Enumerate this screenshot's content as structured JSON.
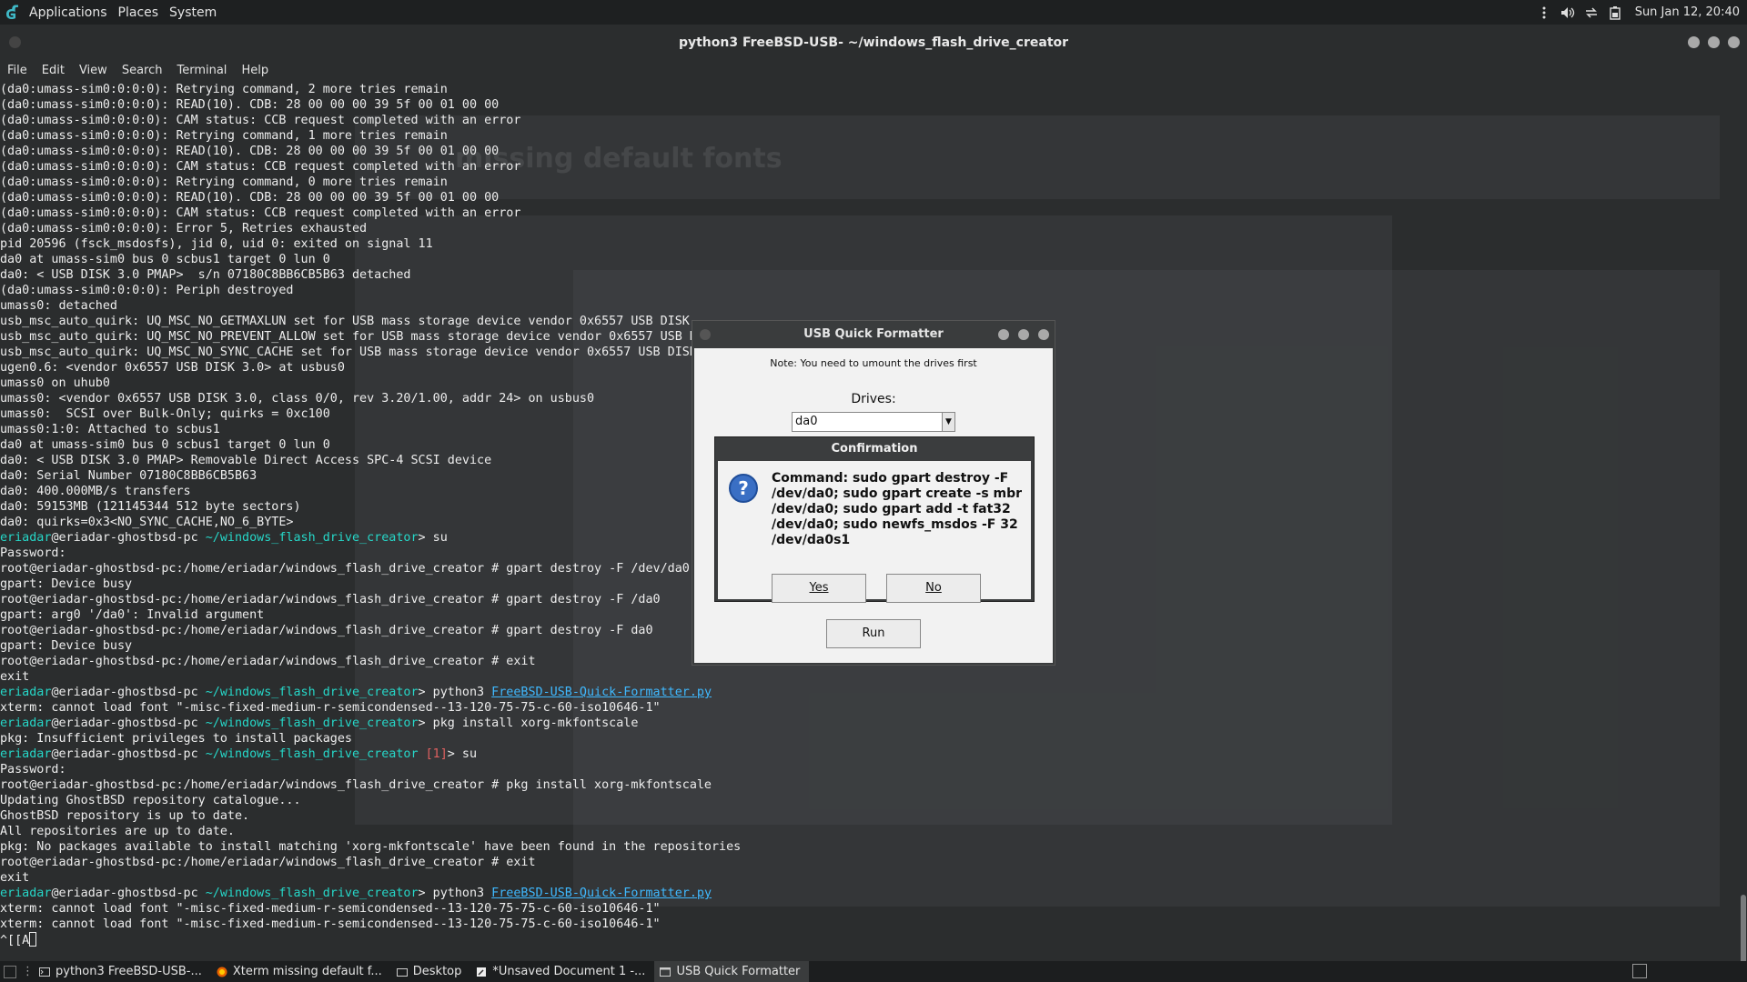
{
  "top_panel": {
    "menus": [
      "Applications",
      "Places",
      "System"
    ],
    "clock": "Sun Jan 12, 20:40"
  },
  "terminal": {
    "title": "python3 FreeBSD-USB- ~/windows_flash_drive_creator",
    "menu": [
      "File",
      "Edit",
      "View",
      "Search",
      "Terminal",
      "Help"
    ],
    "lines": [
      {
        "t": "(da0:umass-sim0:0:0:0): Retrying command, 2 more tries remain"
      },
      {
        "t": "(da0:umass-sim0:0:0:0): READ(10). CDB: 28 00 00 00 39 5f 00 01 00 00"
      },
      {
        "t": "(da0:umass-sim0:0:0:0): CAM status: CCB request completed with an error"
      },
      {
        "t": "(da0:umass-sim0:0:0:0): Retrying command, 1 more tries remain"
      },
      {
        "t": "(da0:umass-sim0:0:0:0): READ(10). CDB: 28 00 00 00 39 5f 00 01 00 00"
      },
      {
        "t": "(da0:umass-sim0:0:0:0): CAM status: CCB request completed with an error"
      },
      {
        "t": "(da0:umass-sim0:0:0:0): Retrying command, 0 more tries remain"
      },
      {
        "t": "(da0:umass-sim0:0:0:0): READ(10). CDB: 28 00 00 00 39 5f 00 01 00 00"
      },
      {
        "t": "(da0:umass-sim0:0:0:0): CAM status: CCB request completed with an error"
      },
      {
        "t": "(da0:umass-sim0:0:0:0): Error 5, Retries exhausted"
      },
      {
        "t": "pid 20596 (fsck_msdosfs), jid 0, uid 0: exited on signal 11"
      },
      {
        "t": "da0 at umass-sim0 bus 0 scbus1 target 0 lun 0"
      },
      {
        "t": "da0: < USB DISK 3.0 PMAP>  s/n 07180C8BB6CB5B63 detached"
      },
      {
        "t": "(da0:umass-sim0:0:0:0): Periph destroyed"
      },
      {
        "t": "umass0: detached"
      },
      {
        "t": "usb_msc_auto_quirk: UQ_MSC_NO_GETMAXLUN set for USB mass storage device vendor 0x6557 USB DISK"
      },
      {
        "t": "usb_msc_auto_quirk: UQ_MSC_NO_PREVENT_ALLOW set for USB mass storage device vendor 0x6557 USB D"
      },
      {
        "t": "usb_msc_auto_quirk: UQ_MSC_NO_SYNC_CACHE set for USB mass storage device vendor 0x6557 USB DISK"
      },
      {
        "t": "ugen0.6: <vendor 0x6557 USB DISK 3.0> at usbus0"
      },
      {
        "t": "umass0 on uhub0"
      },
      {
        "t": "umass0: <vendor 0x6557 USB DISK 3.0, class 0/0, rev 3.20/1.00, addr 24> on usbus0"
      },
      {
        "t": "umass0:  SCSI over Bulk-Only; quirks = 0xc100"
      },
      {
        "t": "umass0:1:0: Attached to scbus1"
      },
      {
        "t": "da0 at umass-sim0 bus 0 scbus1 target 0 lun 0"
      },
      {
        "t": "da0: < USB DISK 3.0 PMAP> Removable Direct Access SPC-4 SCSI device"
      },
      {
        "t": "da0: Serial Number 07180C8BB6CB5B63"
      },
      {
        "t": "da0: 400.000MB/s transfers"
      },
      {
        "t": "da0: 59153MB (121145344 512 byte sectors)"
      },
      {
        "t": "da0: quirks=0x3<NO_SYNC_CACHE,NO_6_BYTE>"
      },
      {
        "user": "eriadar",
        "host": "@eriadar-ghostbsd-pc",
        "path": " ~/windows_flash_drive_creator",
        "cmd": "> su"
      },
      {
        "t": "Password:"
      },
      {
        "t": "root@eriadar-ghostbsd-pc:/home/eriadar/windows_flash_drive_creator # gpart destroy -F /dev/da0"
      },
      {
        "t": "gpart: Device busy"
      },
      {
        "t": "root@eriadar-ghostbsd-pc:/home/eriadar/windows_flash_drive_creator # gpart destroy -F /da0"
      },
      {
        "t": "gpart: arg0 '/da0': Invalid argument"
      },
      {
        "t": "root@eriadar-ghostbsd-pc:/home/eriadar/windows_flash_drive_creator # gpart destroy -F da0"
      },
      {
        "t": "gpart: Device busy"
      },
      {
        "t": "root@eriadar-ghostbsd-pc:/home/eriadar/windows_flash_drive_creator # exit"
      },
      {
        "t": "exit"
      },
      {
        "user": "eriadar",
        "host": "@eriadar-ghostbsd-pc",
        "path": " ~/windows_flash_drive_creator",
        "cmd": "> python3 ",
        "link": "FreeBSD-USB-Quick-Formatter.py"
      },
      {
        "t": "xterm: cannot load font \"-misc-fixed-medium-r-semicondensed--13-120-75-75-c-60-iso10646-1\""
      },
      {
        "user": "eriadar",
        "host": "@eriadar-ghostbsd-pc",
        "path": " ~/windows_flash_drive_creator",
        "cmd": "> pkg install xorg-mkfontscale"
      },
      {
        "t": "pkg: Insufficient privileges to install packages"
      },
      {
        "user": "eriadar",
        "host": "@eriadar-ghostbsd-pc",
        "path": " ~/windows_flash_drive_creator",
        "err": " [1]",
        "cmd": "> su"
      },
      {
        "t": "Password:"
      },
      {
        "t": "root@eriadar-ghostbsd-pc:/home/eriadar/windows_flash_drive_creator # pkg install xorg-mkfontscale"
      },
      {
        "t": "Updating GhostBSD repository catalogue..."
      },
      {
        "t": "GhostBSD repository is up to date."
      },
      {
        "t": "All repositories are up to date."
      },
      {
        "t": "pkg: No packages available to install matching 'xorg-mkfontscale' have been found in the repositories"
      },
      {
        "t": "root@eriadar-ghostbsd-pc:/home/eriadar/windows_flash_drive_creator # exit"
      },
      {
        "t": "exit"
      },
      {
        "user": "eriadar",
        "host": "@eriadar-ghostbsd-pc",
        "path": " ~/windows_flash_drive_creator",
        "cmd": "> python3 ",
        "link": "FreeBSD-USB-Quick-Formatter.py"
      },
      {
        "t": "xterm: cannot load font \"-misc-fixed-medium-r-semicondensed--13-120-75-75-c-60-iso10646-1\""
      },
      {
        "t": "xterm: cannot load font \"-misc-fixed-medium-r-semicondensed--13-120-75-75-c-60-iso10646-1\""
      },
      {
        "t": "^[[A",
        "cursor": true
      }
    ]
  },
  "usb_formatter": {
    "title": "USB Quick Formatter",
    "note": "Note: You need to umount the drives first",
    "drives_label": "Drives:",
    "drive_selected": "da0",
    "run_label": "Run"
  },
  "confirmation": {
    "title": "Confirmation",
    "message": "Command: sudo gpart destroy -F /dev/da0; sudo gpart create -s mbr /dev/da0; sudo gpart add -t fat32 /dev/da0; sudo newfs_msdos -F 32 /dev/da0s1",
    "yes_label": "Yes",
    "no_label": "No"
  },
  "taskbar": {
    "tasks": [
      {
        "label": "python3 FreeBSD-USB-...",
        "icon": "terminal-icon",
        "active": false
      },
      {
        "label": "Xterm missing default f...",
        "icon": "firefox-icon",
        "active": false
      },
      {
        "label": "Desktop",
        "icon": "folder-icon",
        "active": false
      },
      {
        "label": "*Unsaved Document 1 -...",
        "icon": "text-editor-icon",
        "active": false
      },
      {
        "label": "USB Quick Formatter",
        "icon": "window-icon",
        "active": true
      }
    ]
  },
  "colors": {
    "prompt": "#26d7c8",
    "error": "#e06060",
    "link": "#3fb9ff",
    "dialog_accent": "#3a6fc4"
  }
}
